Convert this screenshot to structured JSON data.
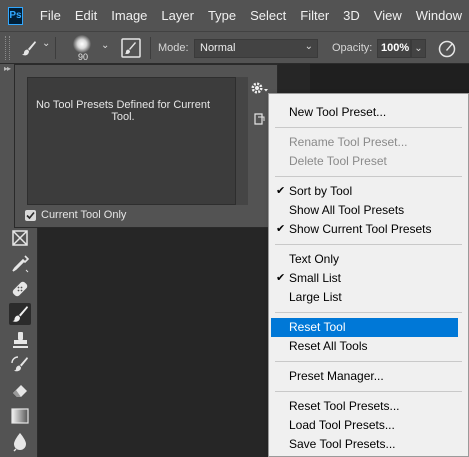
{
  "menubar": {
    "logo": "Ps",
    "items": [
      "File",
      "Edit",
      "Image",
      "Layer",
      "Type",
      "Select",
      "Filter",
      "3D",
      "View",
      "Window"
    ]
  },
  "options_bar": {
    "brush_size": "90",
    "mode_label": "Mode:",
    "mode_value": "Normal",
    "opacity_label": "Opacity:",
    "opacity_value": "100%"
  },
  "tool_presets_panel": {
    "empty_message": "No Tool Presets Defined for Current Tool.",
    "current_tool_only_label": "Current Tool Only",
    "current_tool_only_checked": true
  },
  "flyout_menu": {
    "new_tool_preset": "New Tool Preset...",
    "rename_tool_preset": "Rename Tool Preset...",
    "delete_tool_preset": "Delete Tool Preset",
    "sort_by_tool": "Sort by Tool",
    "show_all_tool_presets": "Show All Tool Presets",
    "show_current_tool_presets": "Show Current Tool Presets",
    "text_only": "Text Only",
    "small_list": "Small List",
    "large_list": "Large List",
    "reset_tool": "Reset Tool",
    "reset_all_tools": "Reset All Tools",
    "preset_manager": "Preset Manager...",
    "reset_tool_presets": "Reset Tool Presets...",
    "load_tool_presets": "Load Tool Presets...",
    "save_tool_presets": "Save Tool Presets..."
  },
  "colors": {
    "highlight": "#0078d7",
    "ui_gray": "#535353",
    "menu_bg": "#f0f0f0"
  }
}
